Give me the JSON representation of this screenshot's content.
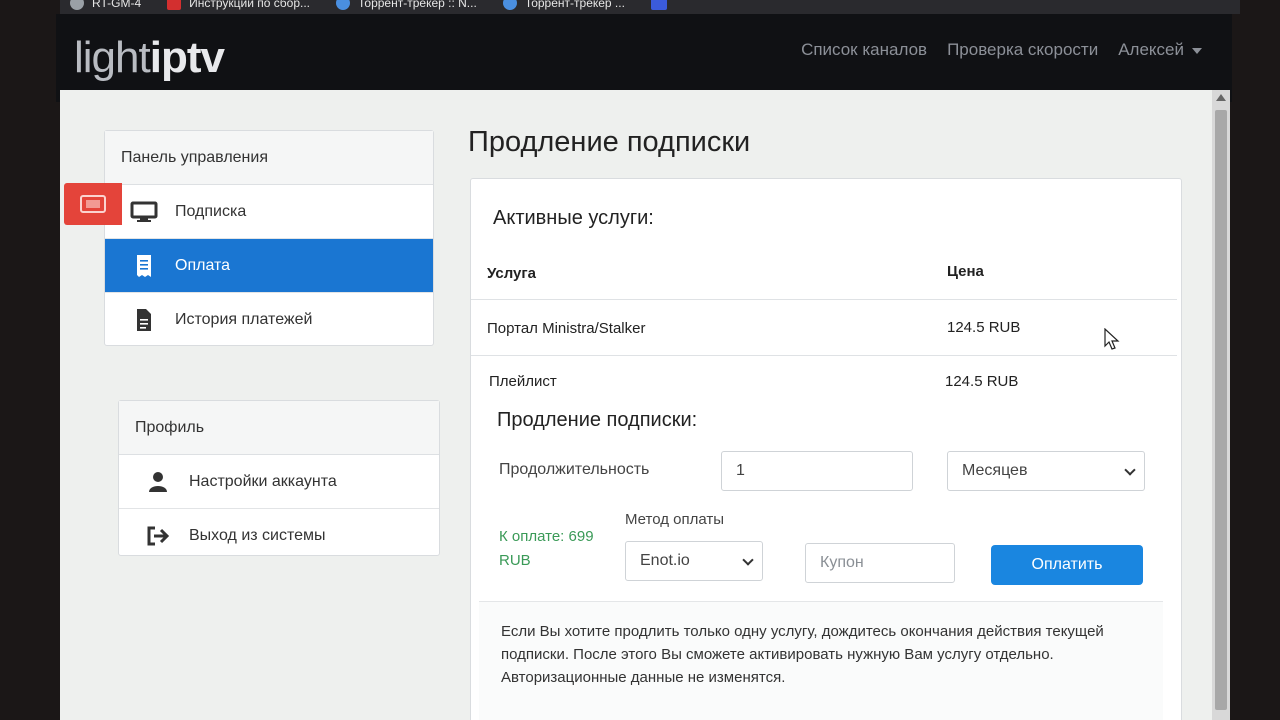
{
  "bookmarks": [
    {
      "label": "RT-GM-4",
      "icon": "globe-icon"
    },
    {
      "label": "Инструкции по сбор...",
      "icon": "lego-icon"
    },
    {
      "label": "Торрент-трекер :: N...",
      "icon": "star-icon"
    },
    {
      "label": "Торрент-трекер ...",
      "icon": "star-icon"
    }
  ],
  "navbar": {
    "logo_light": "light",
    "logo_bold": "iptv",
    "links": [
      "Список каналов",
      "Проверка скорости"
    ],
    "user": "Алексей"
  },
  "sidebar": {
    "control_panel": {
      "title": "Панель управления",
      "items": [
        {
          "label": "Подписка",
          "icon": "monitor-icon"
        },
        {
          "label": "Оплата",
          "icon": "receipt-icon",
          "active": true
        },
        {
          "label": "История платежей",
          "icon": "document-icon"
        }
      ]
    },
    "profile": {
      "title": "Профиль",
      "items": [
        {
          "label": "Настройки аккаунта",
          "icon": "user-icon"
        },
        {
          "label": "Выход из системы",
          "icon": "logout-icon"
        }
      ]
    }
  },
  "main": {
    "title": "Продление подписки",
    "active_services": {
      "heading": "Активные услуги:",
      "columns": [
        "Услуга",
        "Цена"
      ],
      "rows": [
        {
          "service": "Портал Ministra/Stalker",
          "price": "124.5 RUB"
        },
        {
          "service": "Плейлист",
          "price": "124.5 RUB"
        }
      ]
    },
    "renew": {
      "heading": "Продление подписки:",
      "duration_label": "Продолжительность",
      "duration_value": "1",
      "period_value": "Месяцев",
      "amount_label": "К оплате: 699 RUB",
      "method_label": "Метод оплаты",
      "method_value": "Enot.io",
      "coupon_placeholder": "Купон",
      "pay_button": "Оплатить"
    },
    "note": "Если Вы хотите продлить только одну услугу, дождитесь окончания действия текущей подписки. После этого Вы сможете активировать нужную Вам услугу отдельно. Авторизационные данные не изменятся."
  },
  "colors": {
    "accent": "#1a76d2",
    "pay_button": "#1a86e0",
    "amount": "#3a9a57",
    "side_tab": "#e4443a",
    "navbar": "#101114"
  }
}
